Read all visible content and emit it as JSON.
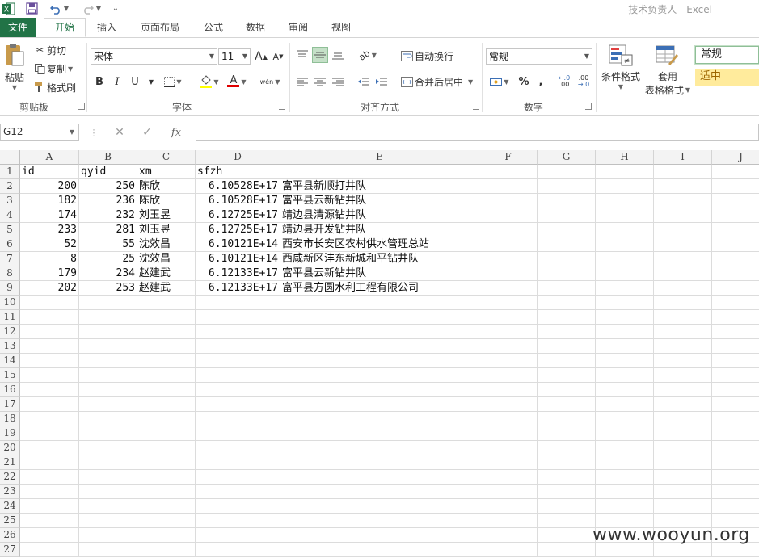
{
  "window": {
    "title": "技术负责人 - Excel"
  },
  "tabs": [
    {
      "label": "文件",
      "kind": "file"
    },
    {
      "label": "开始",
      "kind": "active"
    },
    {
      "label": "插入",
      "kind": ""
    },
    {
      "label": "页面布局",
      "kind": ""
    },
    {
      "label": "公式",
      "kind": ""
    },
    {
      "label": "数据",
      "kind": ""
    },
    {
      "label": "审阅",
      "kind": ""
    },
    {
      "label": "视图",
      "kind": ""
    }
  ],
  "ribbon": {
    "clipboard": {
      "paste": "粘贴",
      "cut": "剪切",
      "copy": "复制",
      "format_painter": "格式刷",
      "label": "剪贴板"
    },
    "font": {
      "name": "宋体",
      "size": "11",
      "grow": "A",
      "shrink": "A",
      "bold": "B",
      "italic": "I",
      "underline": "U",
      "font_color": "A",
      "phonetic": "wén",
      "label": "字体"
    },
    "alignment": {
      "wrap_text": "自动换行",
      "merge_center": "合并后居中",
      "label": "对齐方式"
    },
    "number": {
      "format": "常规",
      "percent": "%",
      "comma": ",",
      "inc_decimal": ".00",
      "dec_decimal": ".00",
      "label": "数字"
    },
    "styles": {
      "conditional": "条件格式",
      "table_format_1": "套用",
      "table_format_2": "表格格式",
      "style_normal": "常规",
      "style_neutral": "适中"
    }
  },
  "formula_bar": {
    "name_box": "G12",
    "fx": "fx",
    "value": ""
  },
  "columns": [
    "A",
    "B",
    "C",
    "D",
    "E",
    "F",
    "G",
    "H",
    "I",
    "J"
  ],
  "rows": [
    "1",
    "2",
    "3",
    "4",
    "5",
    "6",
    "7",
    "8",
    "9",
    "10",
    "11",
    "12",
    "13",
    "14",
    "15",
    "16",
    "17",
    "18",
    "19",
    "20",
    "21",
    "22",
    "23",
    "24",
    "25",
    "26",
    "27"
  ],
  "sheet": [
    [
      "id",
      "qyid",
      "xm",
      "sfzh",
      ""
    ],
    [
      "200",
      "250",
      "陈欣",
      "6.10528E+17",
      "富平县新顺打井队"
    ],
    [
      "182",
      "236",
      "陈欣",
      "6.10528E+17",
      "富平县云新钻井队"
    ],
    [
      "174",
      "232",
      "刘玉昱",
      "6.12725E+17",
      "靖边县清源钻井队"
    ],
    [
      "233",
      "281",
      "刘玉昱",
      "6.12725E+17",
      "靖边县开发钻井队"
    ],
    [
      "52",
      "55",
      "沈效昌",
      "6.10121E+14",
      "西安市长安区农村供水管理总站"
    ],
    [
      "8",
      "25",
      "沈效昌",
      "6.10121E+14",
      "西咸新区沣东新城和平钻井队"
    ],
    [
      "179",
      "234",
      "赵建武",
      "6.12133E+17",
      "富平县云新钻井队"
    ],
    [
      "202",
      "253",
      "赵建武",
      "6.12133E+17",
      "富平县方圆水利工程有限公司"
    ]
  ],
  "watermark": "www.wooyun.org",
  "colors": {
    "excel_green": "#217346",
    "neutral_style_bg": "#ffeb9c",
    "neutral_style_text": "#9c6500"
  }
}
